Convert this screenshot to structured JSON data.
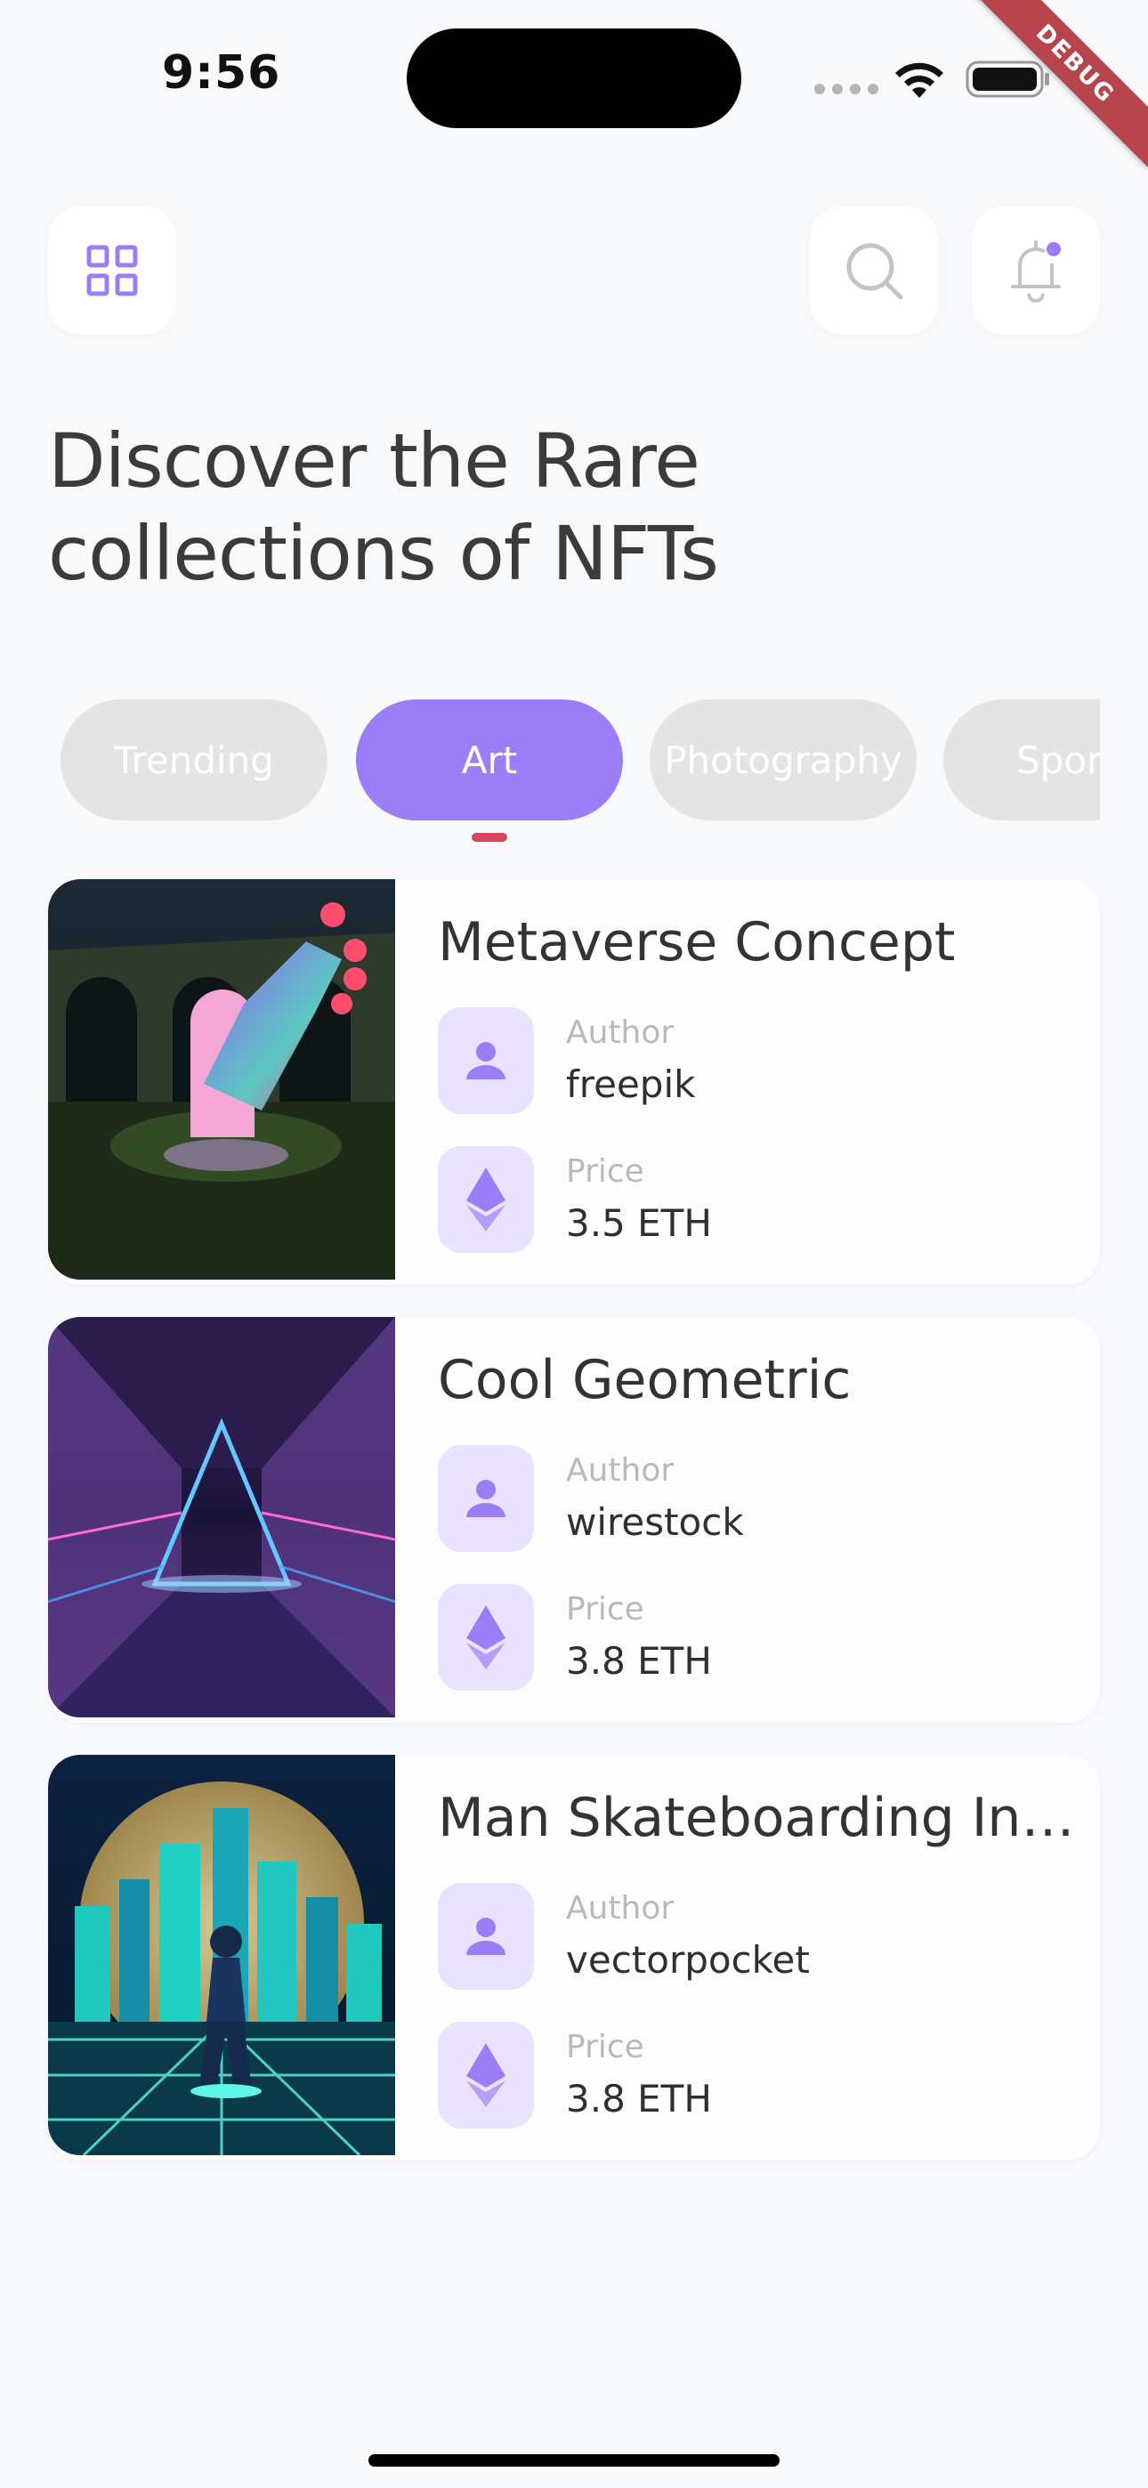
{
  "status_bar": {
    "time": "9:56"
  },
  "debug_banner": "DEBUG",
  "header": {
    "menu_icon": "grid-icon",
    "search_icon": "search-icon",
    "notification_icon": "bell-icon"
  },
  "headline": "Discover the Rare collections of NFTs",
  "tabs": [
    {
      "label": "Trending",
      "active": false
    },
    {
      "label": "Art",
      "active": true
    },
    {
      "label": "Photography",
      "active": false
    },
    {
      "label": "Sports",
      "active": false
    }
  ],
  "cards": [
    {
      "title": "Metaverse Concept",
      "author_label": "Author",
      "author": "freepik",
      "price_label": "Price",
      "price": "3.5 ETH",
      "image": "metaverse-hand-artwork"
    },
    {
      "title": "Cool Geometric",
      "author_label": "Author",
      "author": "wirestock",
      "price_label": "Price",
      "price": "3.8 ETH",
      "image": "neon-geometric-tunnel-artwork"
    },
    {
      "title": "Man Skateboarding In Neon City",
      "author_label": "Author",
      "author": "vectorpocket",
      "price_label": "Price",
      "price": "3.8 ETH",
      "image": "neon-city-skateboarder-artwork"
    }
  ],
  "colors": {
    "accent": "#9b7df8",
    "accent_light": "#eae3ff",
    "tab_inactive": "#e4e4e4",
    "indicator": "#d9445a",
    "background": "#f8f9fb"
  }
}
